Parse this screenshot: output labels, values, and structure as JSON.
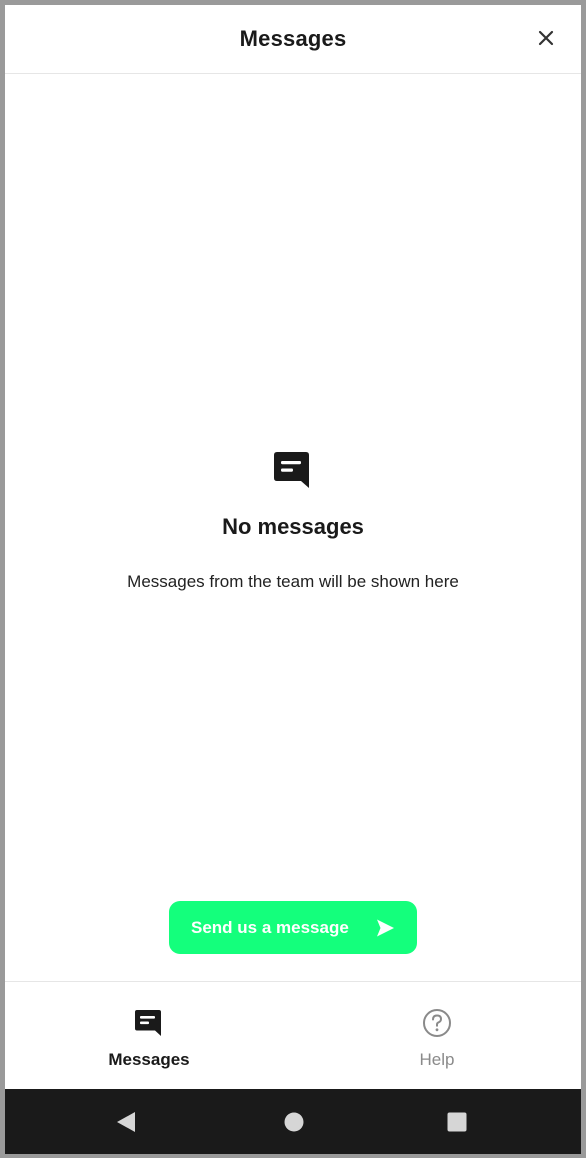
{
  "header": {
    "title": "Messages",
    "close_icon": "close-icon"
  },
  "empty_state": {
    "icon": "message-icon",
    "title": "No messages",
    "subtitle": "Messages from the team will be shown here"
  },
  "send_button": {
    "label": "Send us a message",
    "icon": "send-arrow-icon"
  },
  "tabs": [
    {
      "label": "Messages",
      "icon": "message-icon",
      "active": true
    },
    {
      "label": "Help",
      "icon": "help-question-icon",
      "active": false
    }
  ],
  "android_nav": {
    "buttons": [
      "back-icon",
      "home-icon",
      "recents-icon"
    ]
  },
  "colors": {
    "accent": "#14ff7c",
    "text": "#1a1a1a",
    "inactive": "#8a8a8a",
    "navbar": "#1a1a1a"
  }
}
